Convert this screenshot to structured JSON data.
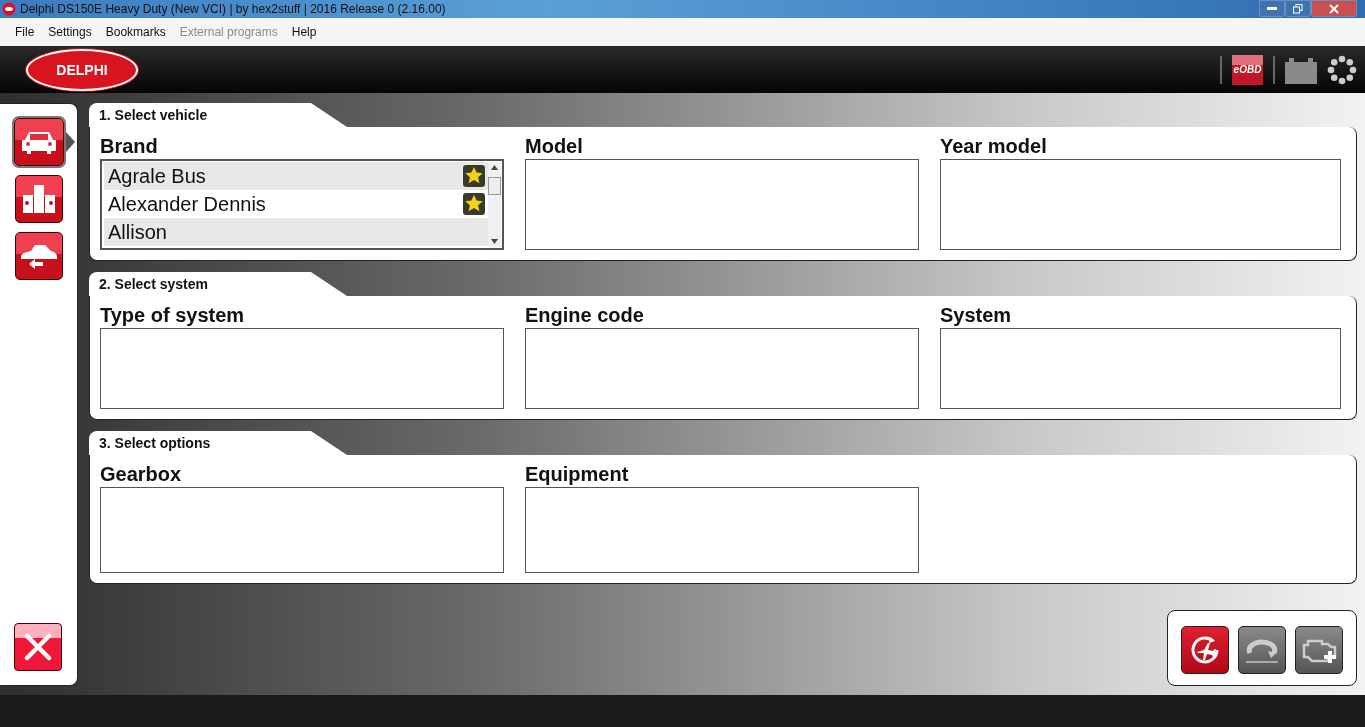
{
  "window": {
    "title": "Delphi DS150E Heavy Duty (New VCI) | by hex2stuff | 2016 Release 0 (2.16.00)"
  },
  "menu": [
    {
      "label": "File",
      "disabled": false
    },
    {
      "label": "Settings",
      "disabled": false
    },
    {
      "label": "Bookmarks",
      "disabled": false
    },
    {
      "label": "External programs",
      "disabled": true
    },
    {
      "label": "Help",
      "disabled": false
    }
  ],
  "header": {
    "logo": "DELPHI",
    "eobd": "eOBD"
  },
  "sidebar": {
    "items": [
      {
        "kind": "vehicle",
        "selected": true
      },
      {
        "kind": "compare",
        "selected": false
      },
      {
        "kind": "back",
        "selected": false
      }
    ]
  },
  "sections": [
    {
      "title": "1. Select vehicle",
      "fields": [
        {
          "label": "Brand",
          "kind": "list",
          "items": [
            {
              "name": "Agrale Bus",
              "favorite": true
            },
            {
              "name": "Alexander Dennis",
              "favorite": true
            },
            {
              "name": "Allison",
              "favorite": false
            }
          ]
        },
        {
          "label": "Model",
          "kind": "box"
        },
        {
          "label": "Year model",
          "kind": "box"
        }
      ]
    },
    {
      "title": "2. Select system",
      "fields": [
        {
          "label": "Type of system",
          "kind": "box"
        },
        {
          "label": "Engine code",
          "kind": "box"
        },
        {
          "label": "System",
          "kind": "box"
        }
      ]
    },
    {
      "title": "3. Select options",
      "fields": [
        {
          "label": "Gearbox",
          "kind": "box"
        },
        {
          "label": "Equipment",
          "kind": "box"
        }
      ]
    }
  ],
  "actions": [
    {
      "kind": "flight",
      "disabled": false
    },
    {
      "kind": "cycle",
      "disabled": true
    },
    {
      "kind": "engine",
      "disabled": true
    }
  ]
}
